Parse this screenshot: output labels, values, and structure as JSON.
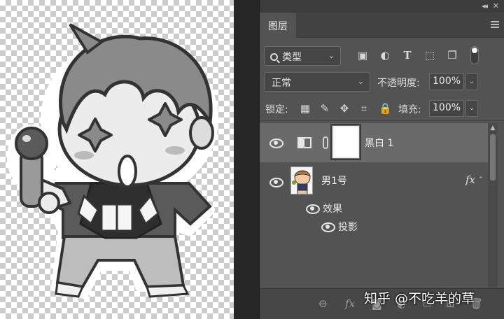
{
  "panel": {
    "collapse_icon": "double-chevron-left-icon",
    "close_icon": "close-icon",
    "tab_layers": "图层",
    "menu_icon": "panel-menu-icon"
  },
  "filter": {
    "kind_label": "类型",
    "icons": [
      "image-filter-icon",
      "adjustment-filter-icon",
      "type-filter-icon",
      "shape-filter-icon",
      "smart-object-filter-icon"
    ]
  },
  "blend": {
    "mode": "正常",
    "opacity_label": "不透明度:",
    "opacity_value": "100%",
    "lock_label": "锁定:",
    "fill_label": "填充:",
    "fill_value": "100%"
  },
  "layers": [
    {
      "name": "黑白 1",
      "type": "adjustment",
      "visible": true,
      "selected": true
    },
    {
      "name": "男1号",
      "type": "image",
      "visible": true,
      "selected": false,
      "fx": "fx"
    }
  ],
  "effects": {
    "label": "效果",
    "items": [
      "投影"
    ]
  },
  "bottom_bar": {
    "icons": [
      "link-layers-icon",
      "add-style-icon",
      "add-mask-icon",
      "adjustment-layer-icon",
      "new-group-icon",
      "new-layer-icon",
      "delete-icon"
    ]
  },
  "watermark": "知乎 @不吃羊的草",
  "colors": {
    "panel_bg": "#535353",
    "selected_row": "#6a6a6a",
    "canvas_dark_checker": "#cccccc"
  }
}
